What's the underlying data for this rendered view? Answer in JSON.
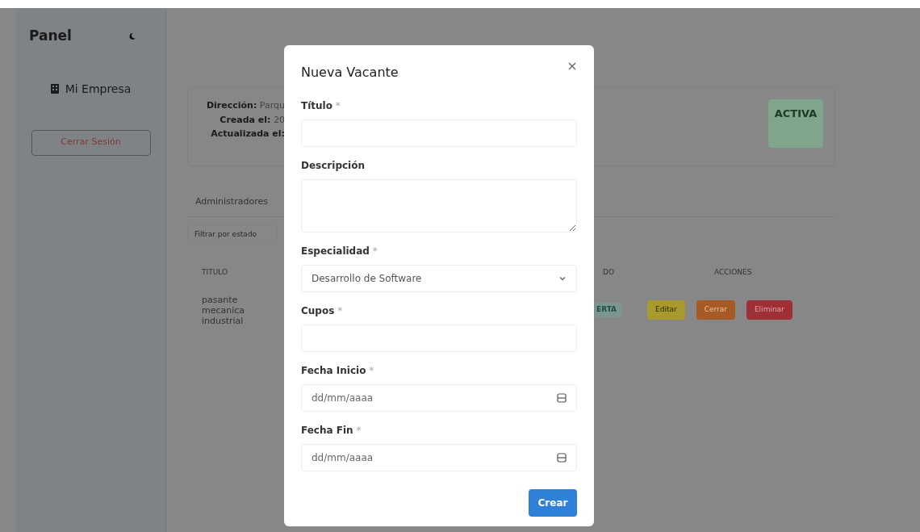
{
  "sidebar": {
    "title": "Panel",
    "items": [
      {
        "label": "Mi Empresa"
      }
    ],
    "logout": "Cerrar Sesión"
  },
  "company": {
    "details": [
      {
        "label": "Dirección:",
        "value": "Parqu"
      },
      {
        "label": "Creada el:",
        "value": "20"
      },
      {
        "label": "Actualizada el:"
      }
    ],
    "status": "ACTIVA"
  },
  "tabs": [
    {
      "label": "Administradores"
    }
  ],
  "filter": {
    "placeholder": "Filtrar por estado"
  },
  "table": {
    "columns": [
      "TITULO",
      "DO",
      "ACCIONES"
    ],
    "rows": [
      {
        "title": "pasante mecanica industrial",
        "status": "ERTA",
        "actions": [
          {
            "label": "Editar",
            "kind": "edit"
          },
          {
            "label": "Cerrar",
            "kind": "close"
          },
          {
            "label": "Eliminar",
            "kind": "delete"
          }
        ]
      }
    ]
  },
  "modal": {
    "title": "Nueva Vacante",
    "fields": [
      {
        "kind": "text",
        "label": "Título",
        "required_mark": "*"
      },
      {
        "kind": "textarea",
        "label": "Descripción"
      },
      {
        "kind": "select",
        "label": "Especialidad",
        "required_mark": "*",
        "value": "Desarrollo de Software"
      },
      {
        "kind": "text",
        "label": "Cupos",
        "required_mark": "*"
      },
      {
        "kind": "date",
        "label": "Fecha Inicio",
        "required_mark": "*",
        "placeholder": "dd/mm/aaaa"
      },
      {
        "kind": "date",
        "label": "Fecha Fin",
        "required_mark": "*",
        "placeholder": "dd/mm/aaaa"
      }
    ],
    "submit": "Crear"
  }
}
